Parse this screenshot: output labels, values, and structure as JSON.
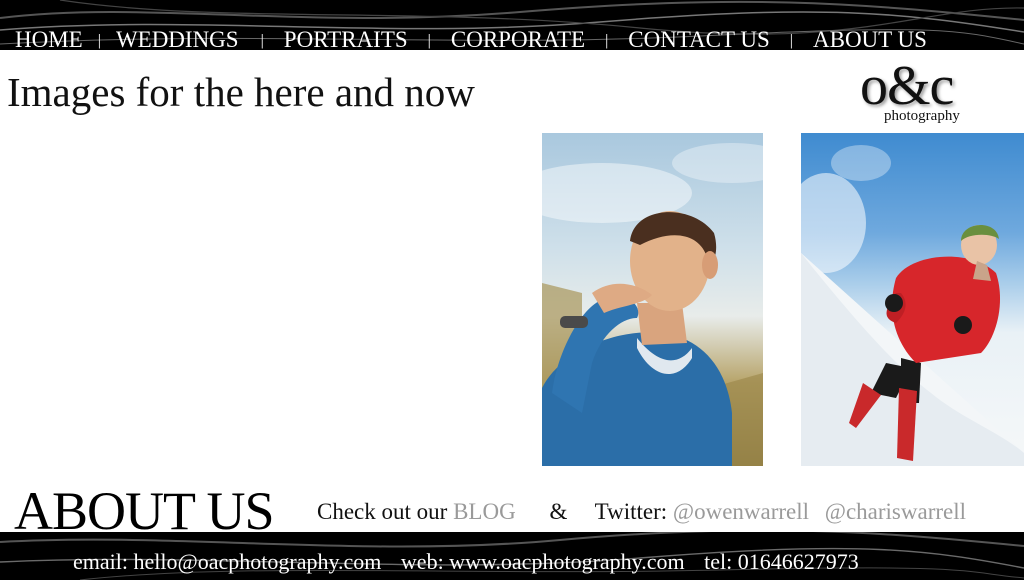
{
  "nav": {
    "items": [
      {
        "label": "HOME"
      },
      {
        "label": "WEDDINGS"
      },
      {
        "label": "PORTRAITS"
      },
      {
        "label": "CORPORATE"
      },
      {
        "label": "CONTACT US"
      },
      {
        "label": "ABOUT US"
      }
    ],
    "separator": "|"
  },
  "tagline": "Images for the here and now",
  "logo": {
    "main": "o&c",
    "sub": "photography"
  },
  "about": {
    "heading": "ABOUT US",
    "check_prefix": "Check out our",
    "blog_link": "BLOG",
    "amp": "&",
    "twitter_label": "Twitter:",
    "twitter_handles": [
      "@owenwarrell",
      "@chariswarrell"
    ]
  },
  "footer": {
    "email": "email: hello@oacphotography.com",
    "web": "web: www.oacphotography.com",
    "tel": "tel: 01646627973"
  },
  "colors": {
    "banner": "#000000",
    "text": "#111111",
    "muted_link": "#9a9a9a",
    "jacket": "#d7262b",
    "hoodie": "#2b6ea8"
  }
}
